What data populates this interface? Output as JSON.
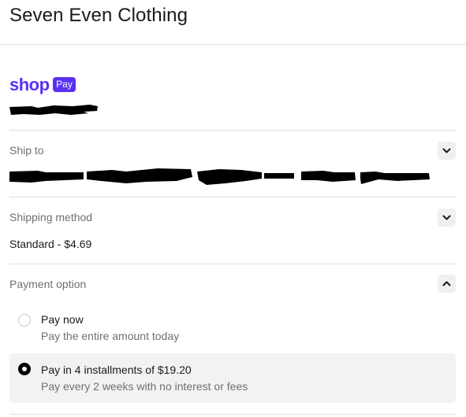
{
  "header": {
    "store_name": "Seven Even Clothing"
  },
  "shop_pay": {
    "logo_word": "shop",
    "badge": "Pay"
  },
  "sections": {
    "ship_to": {
      "label": "Ship to"
    },
    "shipping_method": {
      "label": "Shipping method",
      "value": "Standard - $4.69"
    },
    "payment_option": {
      "label": "Payment option",
      "options": [
        {
          "title": "Pay now",
          "subtitle": "Pay the entire amount today",
          "selected": false
        },
        {
          "title": "Pay in 4 installments of $19.20",
          "subtitle": "Pay every 2 weeks with no interest or fees",
          "selected": true
        }
      ]
    }
  },
  "colors": {
    "brand": "#5a31f4",
    "muted_text": "#707070",
    "divider": "#dedede",
    "selected_option_bg": "#f2f2f2"
  },
  "icons": {
    "ship_to_toggle": "chevron-down-icon",
    "shipping_method_toggle": "chevron-down-icon",
    "payment_option_toggle": "chevron-up-icon"
  }
}
